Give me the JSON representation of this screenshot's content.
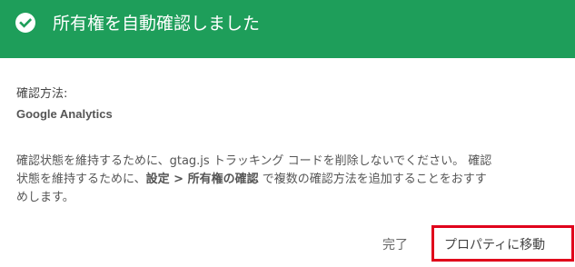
{
  "header": {
    "title": "所有権を自動確認しました",
    "icon": "check-circle-icon",
    "background": "#1e9e5a"
  },
  "verification": {
    "method_label": "確認方法:",
    "method_value": "Google Analytics"
  },
  "description": {
    "line1": "確認状態を維持するために、gtag.js トラッキング コードを削除しないでください。 確認",
    "line2_prefix": "状態を維持するために、",
    "line2_bold": "設定 > 所有権の確認",
    "line2_suffix": " で複数の確認方法を追加することをおすす",
    "line3": "めします。"
  },
  "actions": {
    "done_label": "完了",
    "go_to_property_label": "プロパティに移動",
    "highlight_color": "#e0001b"
  }
}
